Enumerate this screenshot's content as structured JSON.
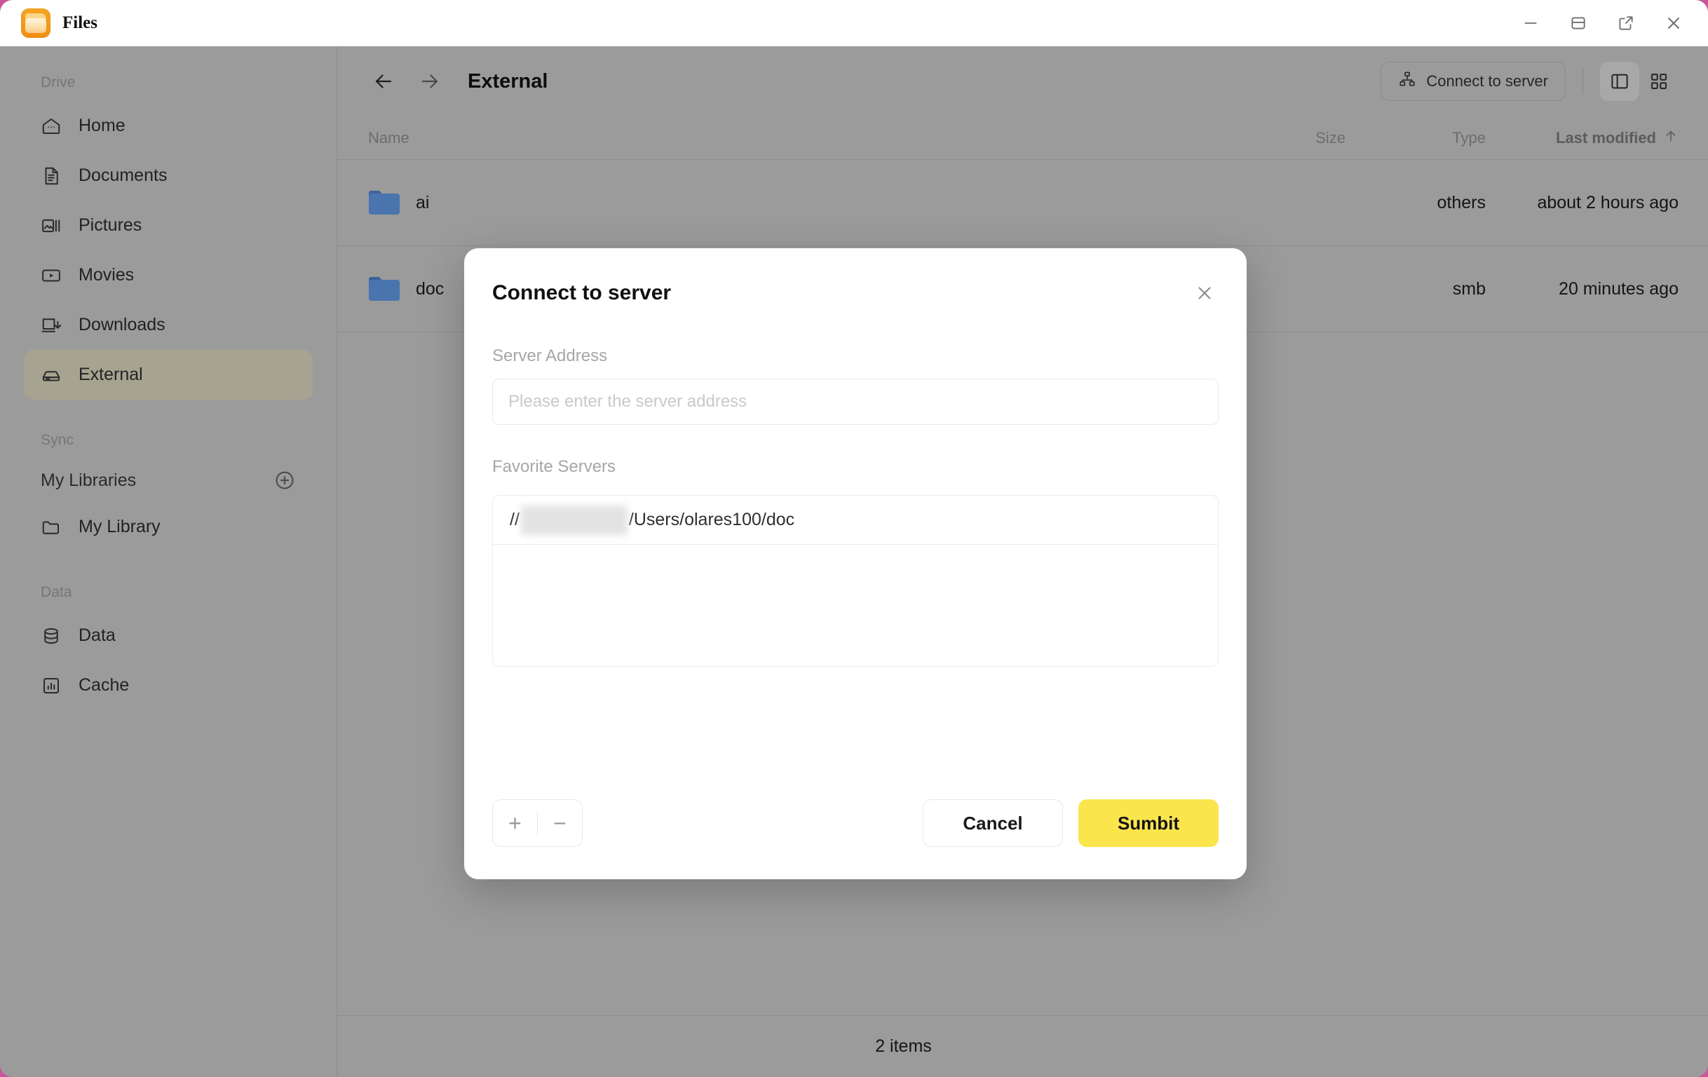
{
  "window": {
    "app_title": "Files",
    "app_icon": "folder-app-icon",
    "controls": [
      {
        "name": "minimize",
        "icon": "minimize-icon"
      },
      {
        "name": "restore",
        "icon": "split-pane-icon"
      },
      {
        "name": "popout",
        "icon": "external-link-icon"
      },
      {
        "name": "close",
        "icon": "close-icon"
      }
    ]
  },
  "sidebar": {
    "groups": [
      {
        "label": "Drive",
        "items": [
          {
            "label": "Home",
            "icon": "home-icon",
            "active": false
          },
          {
            "label": "Documents",
            "icon": "document-icon",
            "active": false
          },
          {
            "label": "Pictures",
            "icon": "pictures-icon",
            "active": false
          },
          {
            "label": "Movies",
            "icon": "movies-icon",
            "active": false
          },
          {
            "label": "Downloads",
            "icon": "downloads-icon",
            "active": false
          },
          {
            "label": "External",
            "icon": "external-drive-icon",
            "active": true
          }
        ]
      },
      {
        "label": "Sync",
        "header_row": {
          "label": "My Libraries",
          "action_icon": "plus-circle-icon"
        },
        "items": [
          {
            "label": "My Library",
            "icon": "folder-icon",
            "active": false
          }
        ]
      },
      {
        "label": "Data",
        "items": [
          {
            "label": "Data",
            "icon": "database-icon",
            "active": false
          },
          {
            "label": "Cache",
            "icon": "chart-box-icon",
            "active": false
          }
        ]
      }
    ]
  },
  "main": {
    "back_icon": "arrow-left-icon",
    "forward_icon": "arrow-right-icon",
    "breadcrumb": "External",
    "connect_button": {
      "label": "Connect to server",
      "icon": "sitemap-icon"
    },
    "view_toggles": [
      {
        "name": "list-view",
        "icon": "panel-view-icon",
        "active": true
      },
      {
        "name": "grid-view",
        "icon": "grid-view-icon",
        "active": false
      }
    ],
    "table": {
      "columns": {
        "name": "Name",
        "size": "Size",
        "type": "Type",
        "modified": "Last modified"
      },
      "sort_icon": "arrow-up-icon",
      "rows": [
        {
          "name": "ai",
          "icon": "folder-icon",
          "size": "",
          "type": "others",
          "modified": "about 2 hours ago"
        },
        {
          "name": "doc",
          "icon": "folder-icon",
          "size": "",
          "type": "smb",
          "modified": "20 minutes ago"
        }
      ]
    },
    "status": "2 items"
  },
  "dialog": {
    "title": "Connect to server",
    "close_icon": "close-icon",
    "server_address": {
      "label": "Server Address",
      "placeholder": "Please enter the server address",
      "value": ""
    },
    "favorites": {
      "label": "Favorite Servers",
      "items": [
        {
          "prefix": "//",
          "redacted": true,
          "suffix": "/Users/olares100/doc"
        }
      ]
    },
    "stepper": {
      "add": "+",
      "remove": "−"
    },
    "cancel_label": "Cancel",
    "submit_label": "Sumbit"
  },
  "colors": {
    "accent_yellow": "#fbe54d",
    "sidebar_bg": "#9b9b9b",
    "sidebar_active": "#a6a491",
    "folder_blue": "#4a74ad",
    "desktop_pink": "#c9559b"
  }
}
